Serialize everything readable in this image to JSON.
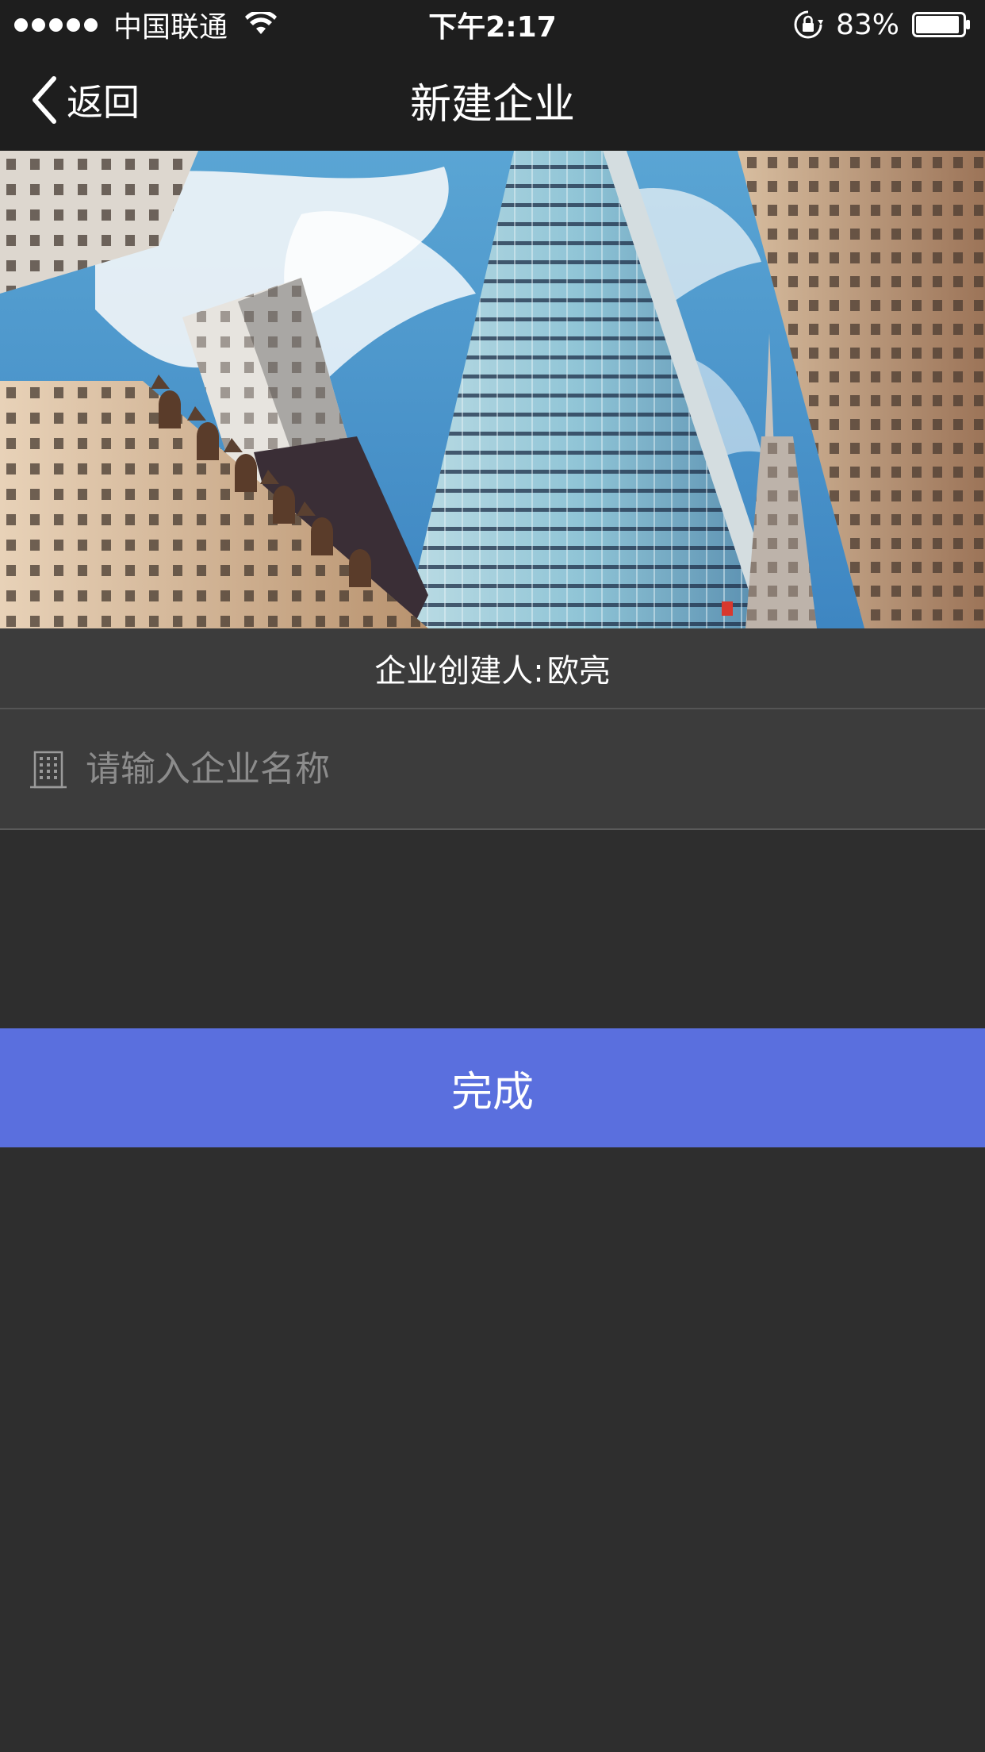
{
  "status_bar": {
    "carrier": "中国联通",
    "time": "下午2:17",
    "battery_percent": "83%"
  },
  "nav": {
    "back_label": "返回",
    "title": "新建企业"
  },
  "banner": {
    "icon": "city-skyscraper-photo"
  },
  "creator": {
    "label": "企业创建人:",
    "name": "欧亮"
  },
  "company_input": {
    "value": "",
    "placeholder": "请输入企业名称",
    "icon": "building-icon"
  },
  "done_button": {
    "label": "完成",
    "color": "#5a6fde"
  }
}
